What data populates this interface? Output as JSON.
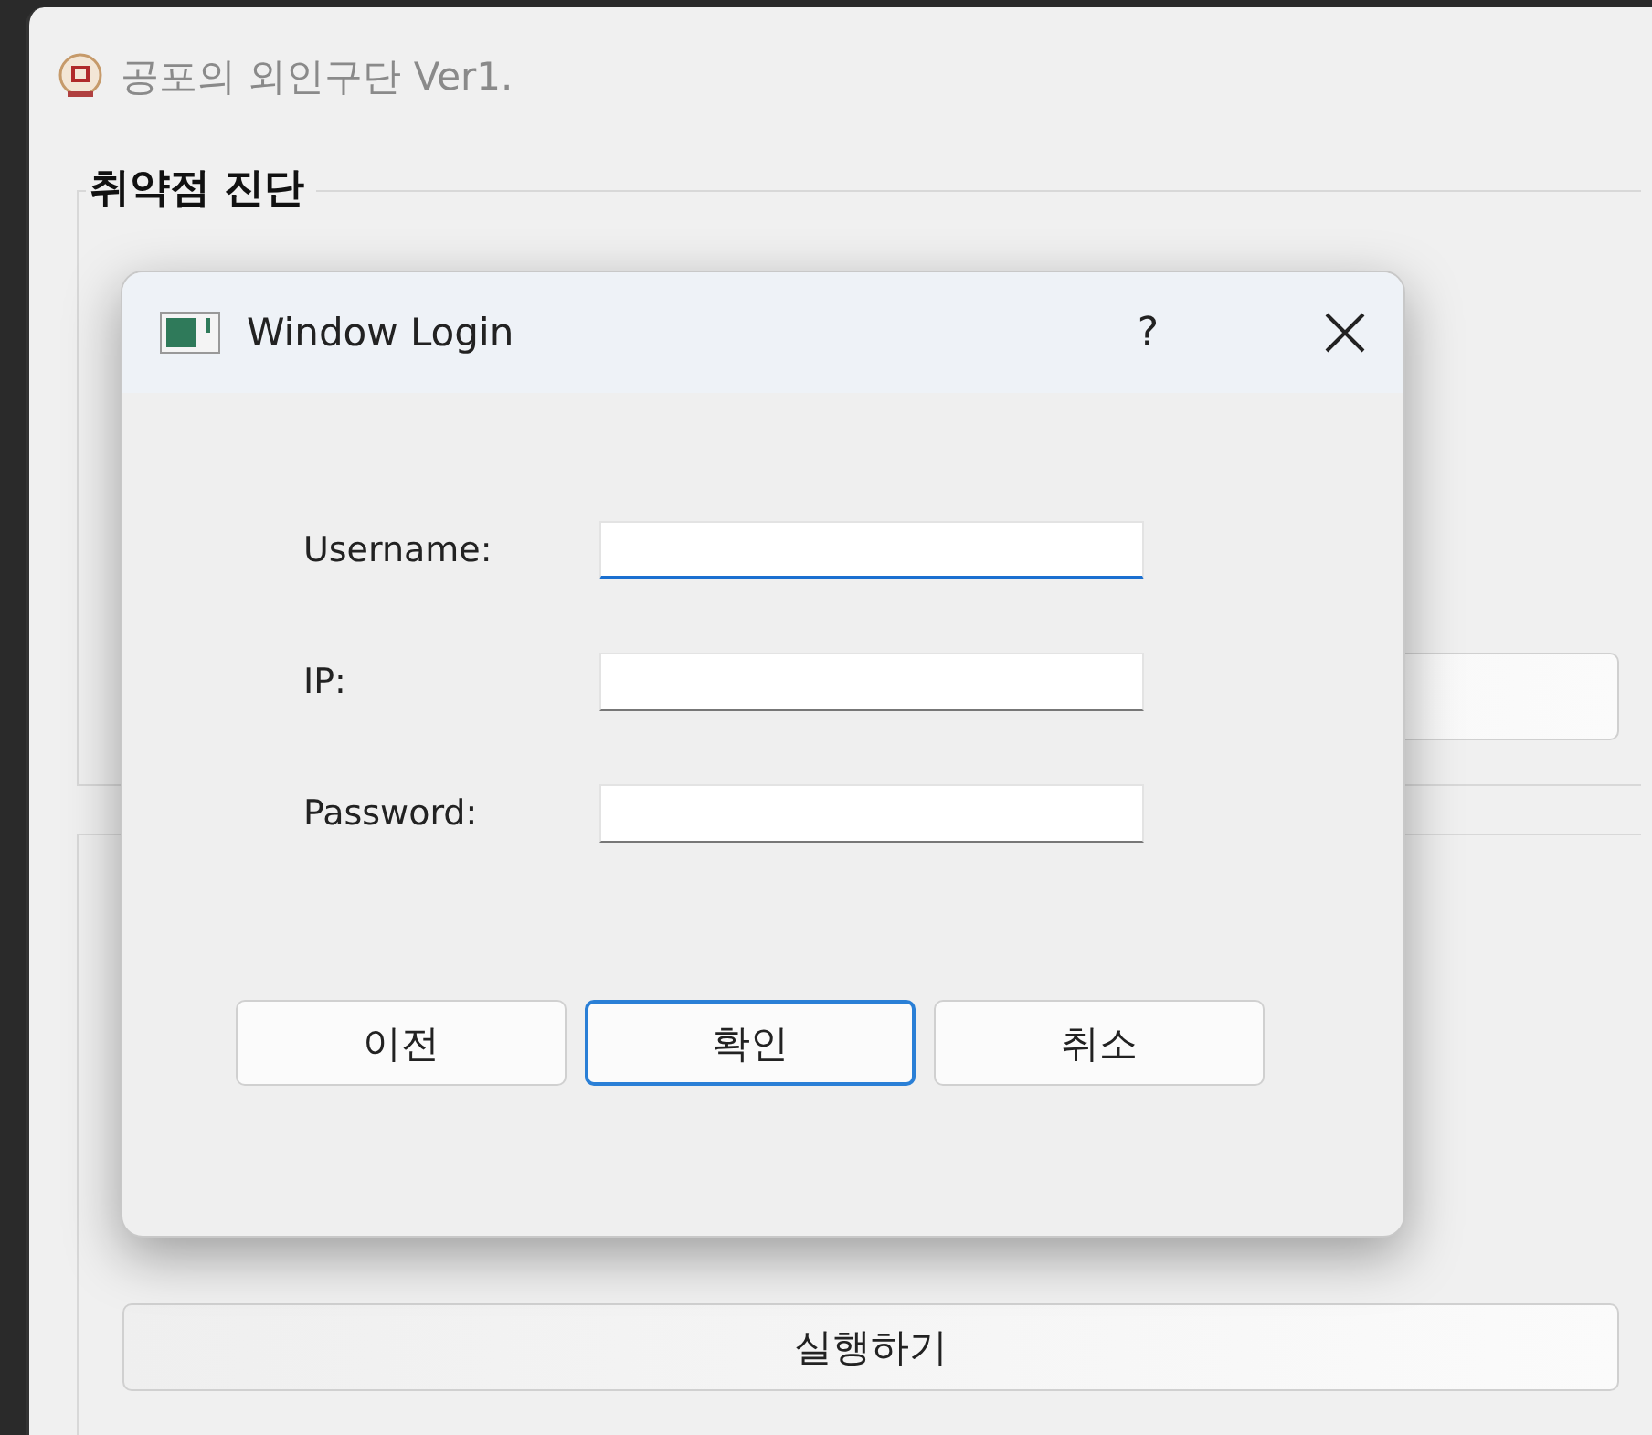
{
  "window": {
    "title": "공포의 외인구단 Ver1."
  },
  "group": {
    "title": "취약점 진단"
  },
  "run_button": {
    "label": "실행하기"
  },
  "dialog": {
    "title": "Window Login",
    "help": "?",
    "fields": [
      {
        "label": "Username:",
        "focused": true
      },
      {
        "label": "IP:",
        "focused": false
      },
      {
        "label": "Password:",
        "focused": false
      }
    ],
    "buttons": [
      {
        "label": "이전",
        "default": false
      },
      {
        "label": "확인",
        "default": true
      },
      {
        "label": "취소",
        "default": false
      }
    ]
  }
}
